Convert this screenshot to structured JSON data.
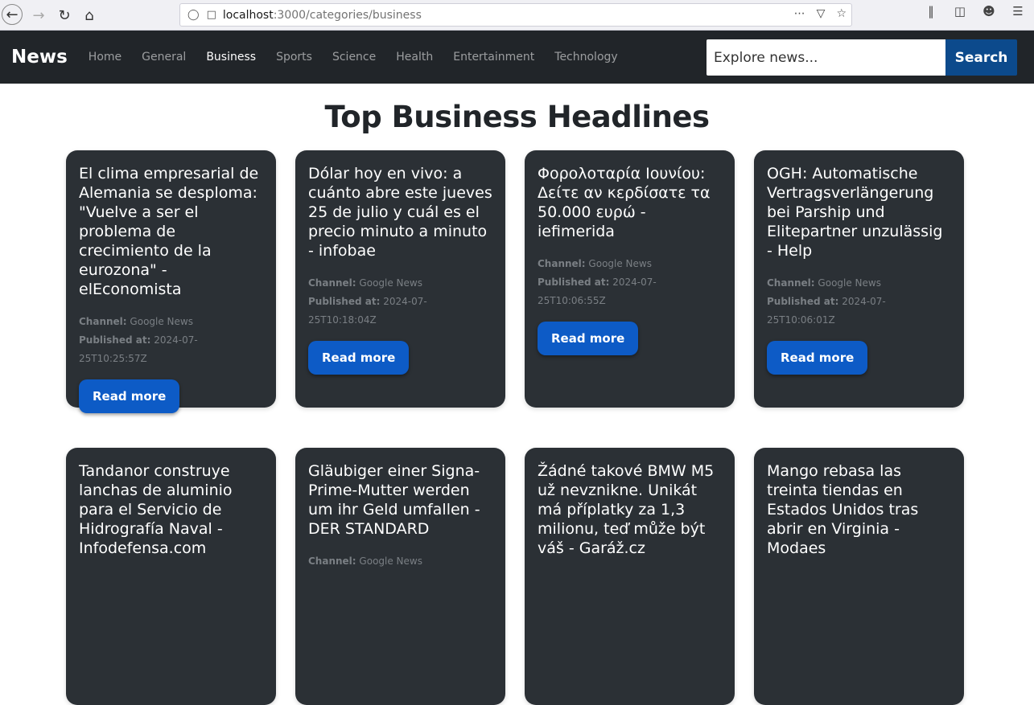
{
  "browser": {
    "url_host": "localhost",
    "url_path": ":3000/categories/business"
  },
  "navbar": {
    "brand": "News",
    "links": [
      {
        "label": "Home",
        "active": false
      },
      {
        "label": "General",
        "active": false
      },
      {
        "label": "Business",
        "active": true
      },
      {
        "label": "Sports",
        "active": false
      },
      {
        "label": "Science",
        "active": false
      },
      {
        "label": "Health",
        "active": false
      },
      {
        "label": "Entertainment",
        "active": false
      },
      {
        "label": "Technology",
        "active": false
      }
    ],
    "search_placeholder": "Explore news...",
    "search_button": "Search"
  },
  "main": {
    "title": "Top Business Headlines",
    "channel_label": "Channel:",
    "published_label": "Published at:",
    "read_more_label": "Read more",
    "articles": [
      {
        "title": "El clima empresarial de Alemania se desploma: \"Vuelve a ser el problema de crecimiento de la eurozona\" - elEconomista",
        "channel": "Google News",
        "published": "2024-07-25T10:25:57Z"
      },
      {
        "title": "Dólar hoy en vivo: a cuánto abre este jueves 25 de julio y cuál es el precio minuto a minuto - infobae",
        "channel": "Google News",
        "published": "2024-07-25T10:18:04Z"
      },
      {
        "title": "Φορολοταρία Ιουνίου: Δείτε αν κερδίσατε τα 50.000 ευρώ - iefimerida",
        "channel": "Google News",
        "published": "2024-07-25T10:06:55Z"
      },
      {
        "title": "OGH: Automatische Vertragsverlängerung bei Parship und Elitepartner unzulässig - Help",
        "channel": "Google News",
        "published": "2024-07-25T10:06:01Z"
      },
      {
        "title": "Tandanor construye lanchas de aluminio para el Servicio de Hidrografía Naval - Infodefensa.com",
        "channel": "",
        "published": ""
      },
      {
        "title": "Gläubiger einer Signa-Prime-Mutter werden um ihr Geld umfallen - DER STANDARD",
        "channel": "Google News",
        "published": ""
      },
      {
        "title": "Žádné takové BMW M5 už nevznikne. Unikát má příplatky za 1,3 milionu, teď může být váš - Garáž.cz",
        "channel": "",
        "published": ""
      },
      {
        "title": "Mango rebasa las treinta tiendas en Estados Unidos tras abrir en Virginia - Modaes",
        "channel": "",
        "published": ""
      }
    ]
  }
}
